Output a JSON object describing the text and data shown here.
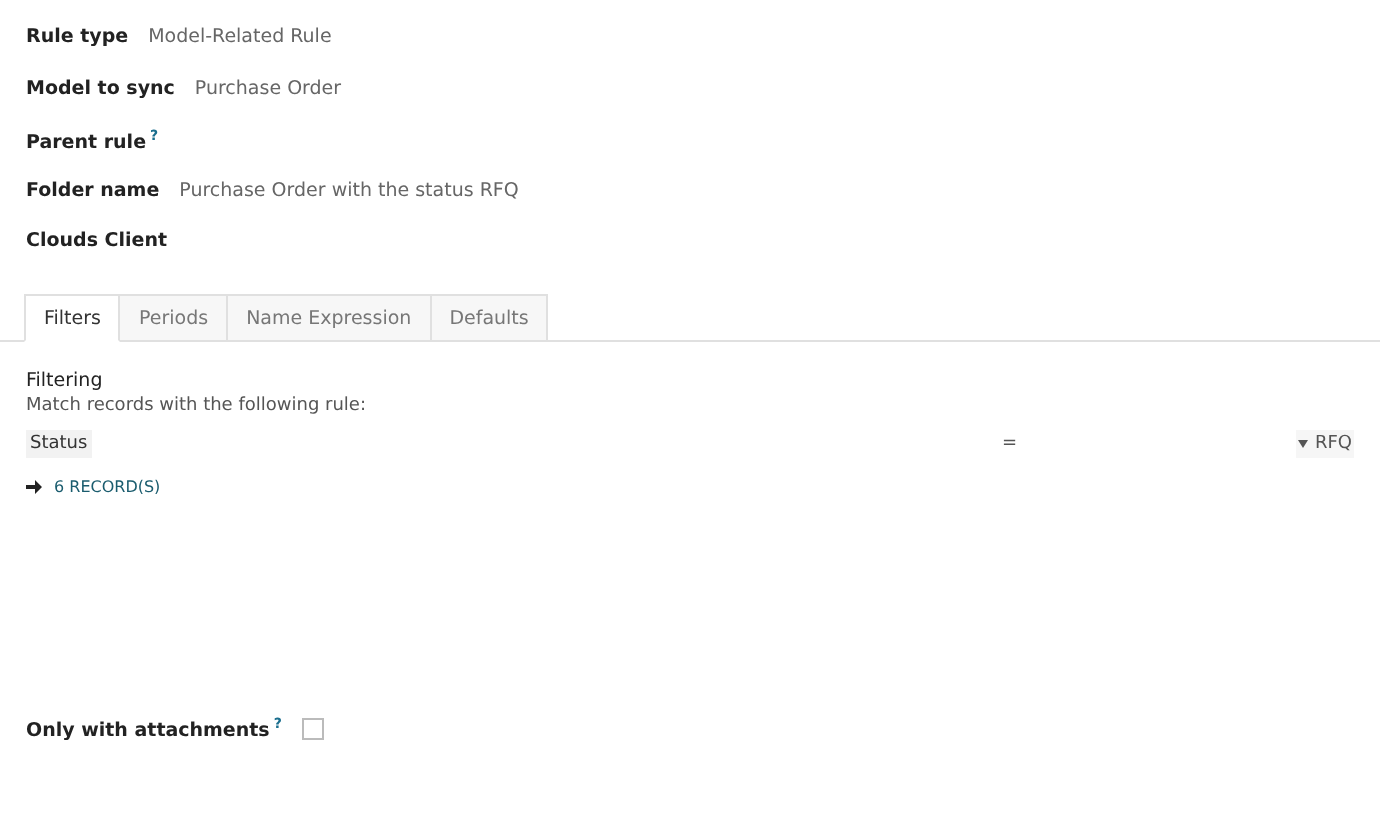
{
  "fields": [
    {
      "label": "Rule type",
      "value": "Model-Related Rule"
    },
    {
      "label": "Model to sync",
      "value": "Purchase Order"
    },
    {
      "label": "Parent rule",
      "help": "?"
    },
    {
      "label": "Folder name",
      "value": "Purchase Order with the status RFQ"
    },
    {
      "label": "Clouds Client"
    }
  ],
  "tabs": [
    {
      "label": "Filters",
      "selected": true
    },
    {
      "label": "Periods",
      "selected": false
    },
    {
      "label": "Name Expression",
      "selected": false
    },
    {
      "label": "Defaults",
      "selected": false
    }
  ],
  "filtering": {
    "title": "Filtering",
    "description": "Match records with the following rule:",
    "rule": {
      "field": "Status",
      "operator": "=",
      "value": "RFQ"
    },
    "records_link": "6 RECORD(S)"
  },
  "attachments": {
    "label": "Only with attachments",
    "help": "?",
    "checked": false
  }
}
